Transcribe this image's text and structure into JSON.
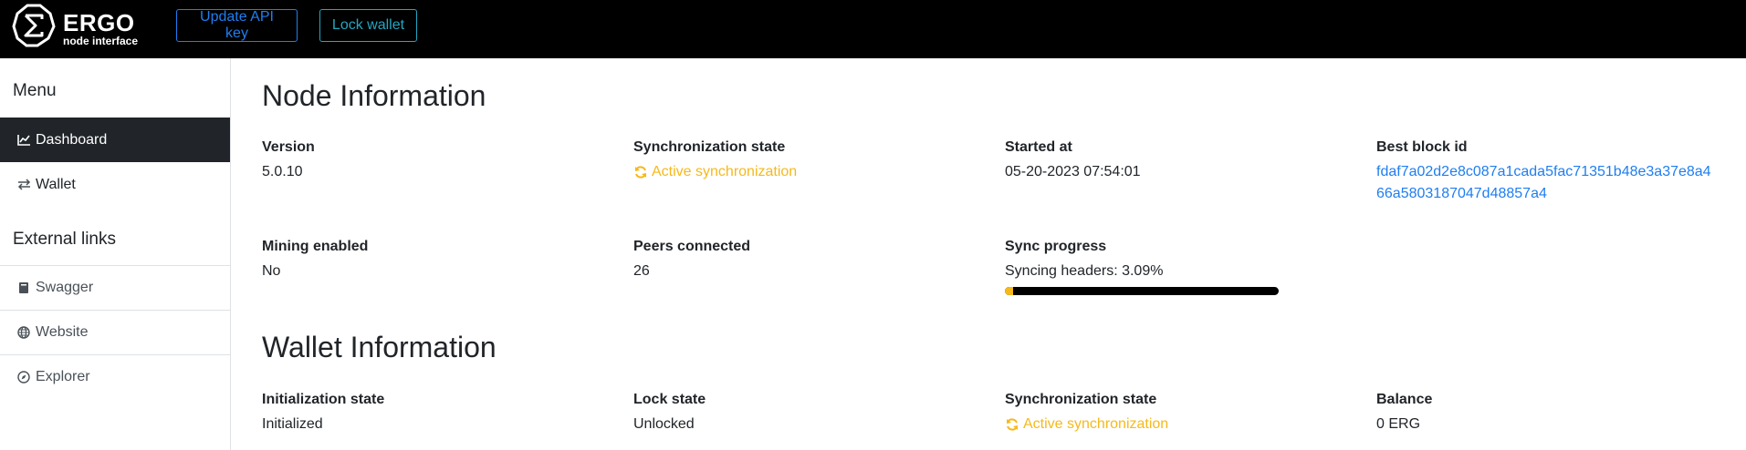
{
  "header": {
    "logo_title": "ERGO",
    "logo_subtitle": "node interface",
    "update_api_key_label": "Update API key",
    "lock_wallet_label": "Lock wallet"
  },
  "sidebar": {
    "menu_title": "Menu",
    "items": [
      {
        "label": "Dashboard",
        "icon": "chart-line-icon",
        "active": true
      },
      {
        "label": "Wallet",
        "icon": "exchange-arrows-icon",
        "active": false
      }
    ],
    "external_title": "External links",
    "external_items": [
      {
        "label": "Swagger",
        "icon": "book-icon"
      },
      {
        "label": "Website",
        "icon": "globe-icon"
      },
      {
        "label": "Explorer",
        "icon": "compass-icon"
      }
    ]
  },
  "node_info": {
    "title": "Node Information",
    "version_label": "Version",
    "version_value": "5.0.10",
    "sync_state_label": "Synchronization state",
    "sync_state_value": "Active synchronization",
    "started_label": "Started at",
    "started_value": "05-20-2023 07:54:01",
    "best_block_label": "Best block id",
    "best_block_value": "fdaf7a02d2e8c087a1cada5fac71351b48e3a37e8a466a5803187047d48857a4",
    "mining_label": "Mining enabled",
    "mining_value": "No",
    "peers_label": "Peers connected",
    "peers_value": "26",
    "sync_progress_label": "Sync progress",
    "sync_progress_text": "Syncing headers: 3.09%",
    "sync_progress_percent": 3.09
  },
  "wallet_info": {
    "title": "Wallet Information",
    "init_label": "Initialization state",
    "init_value": "Initialized",
    "lock_label": "Lock state",
    "lock_value": "Unlocked",
    "sync_label": "Synchronization state",
    "sync_value": "Active synchronization",
    "balance_label": "Balance",
    "balance_value": "0 ERG"
  },
  "colors": {
    "topbar": "#000000",
    "sync_accent": "#f6b91a",
    "link": "#1f7ef0",
    "lock_button": "#23a7c2",
    "active_item": "#212529"
  }
}
